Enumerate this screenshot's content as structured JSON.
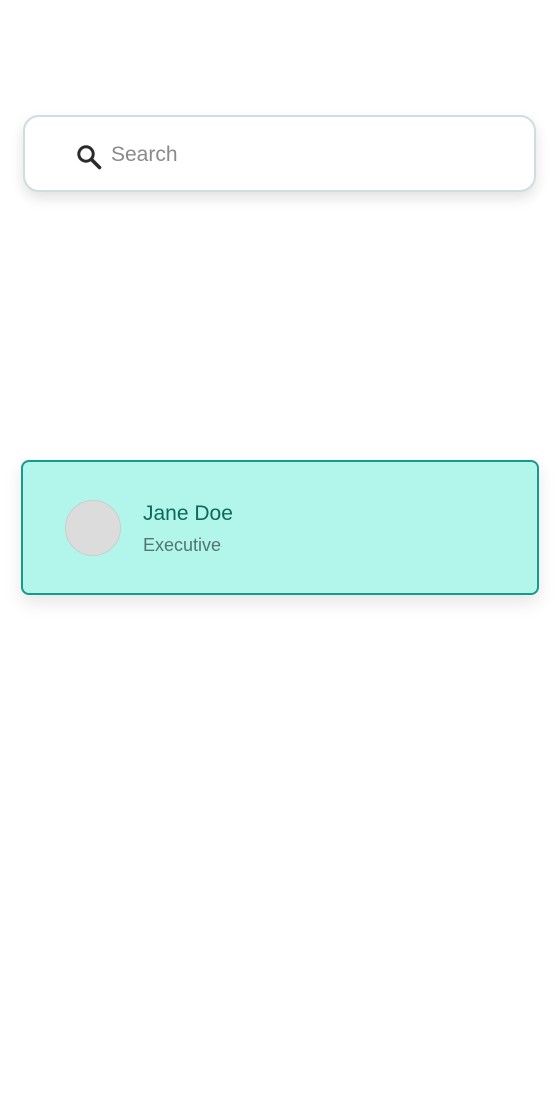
{
  "search": {
    "placeholder": "Search",
    "value": "",
    "icon": "search-icon"
  },
  "contacts": [
    {
      "name": "Jane Doe",
      "role": "Executive",
      "selected": true
    }
  ],
  "colors": {
    "card_background": "#b2f5ea",
    "card_border": "#159a8c",
    "name_text": "#0c6b5c",
    "role_text": "#527570",
    "avatar_placeholder": "#dcdcdc"
  }
}
